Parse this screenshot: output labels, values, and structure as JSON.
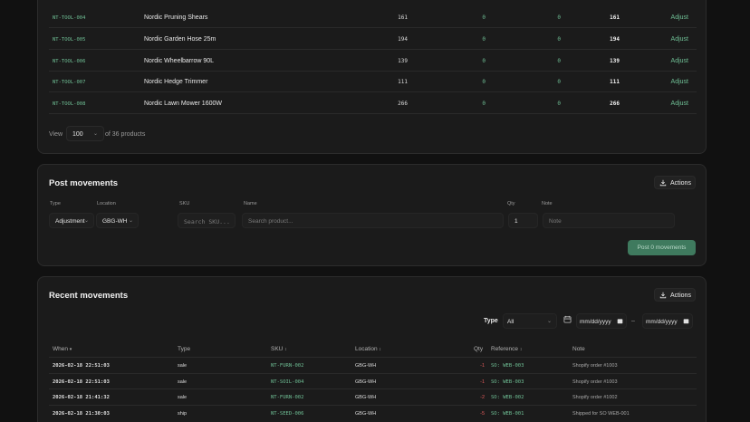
{
  "products": {
    "rows": [
      {
        "sku": "NT-TOOL-004",
        "name": "Nordic Pruning Shears",
        "on_hand": "161",
        "reserved": "0",
        "incoming": "0",
        "available": "161",
        "action": "Adjust"
      },
      {
        "sku": "NT-TOOL-005",
        "name": "Nordic Garden Hose 25m",
        "on_hand": "194",
        "reserved": "0",
        "incoming": "0",
        "available": "194",
        "action": "Adjust"
      },
      {
        "sku": "NT-TOOL-006",
        "name": "Nordic Wheelbarrow 90L",
        "on_hand": "139",
        "reserved": "0",
        "incoming": "0",
        "available": "139",
        "action": "Adjust"
      },
      {
        "sku": "NT-TOOL-007",
        "name": "Nordic Hedge Trimmer",
        "on_hand": "111",
        "reserved": "0",
        "incoming": "0",
        "available": "111",
        "action": "Adjust"
      },
      {
        "sku": "NT-TOOL-008",
        "name": "Nordic Lawn Mower 1600W",
        "on_hand": "266",
        "reserved": "0",
        "incoming": "0",
        "available": "266",
        "action": "Adjust"
      }
    ],
    "view_label": "View",
    "view_value": "100",
    "count_text": "of 36 products"
  },
  "post": {
    "title": "Post movements",
    "actions_label": "Actions",
    "labels": {
      "type": "Type",
      "location": "Location",
      "sku": "SKU",
      "name": "Name",
      "qty": "Qty",
      "note": "Note"
    },
    "type_value": "Adjustment",
    "location_value": "GBG-WH",
    "sku_placeholder": "Search SKU...",
    "name_placeholder": "Search product...",
    "qty_value": "1",
    "note_placeholder": "Note",
    "submit_label": "Post 0 movements"
  },
  "recent": {
    "title": "Recent movements",
    "actions_label": "Actions",
    "filter_type_label": "Type",
    "filter_type_value": "All",
    "date_placeholder": "mm/dd/yyyy",
    "date_sep": "–",
    "headers": {
      "when": "When",
      "type": "Type",
      "sku": "SKU",
      "location": "Location",
      "qty": "Qty",
      "reference": "Reference",
      "note": "Note"
    },
    "rows": [
      {
        "when": "2026-02-18 22:51:03",
        "type": "sale",
        "sku": "NT-FURN-002",
        "location": "GBG-WH",
        "qty": "-1",
        "reference": "SO: WEB-003",
        "note": "Shopify order #1003"
      },
      {
        "when": "2026-02-18 22:51:03",
        "type": "sale",
        "sku": "NT-SOIL-004",
        "location": "GBG-WH",
        "qty": "-1",
        "reference": "SO: WEB-003",
        "note": "Shopify order #1003"
      },
      {
        "when": "2026-02-18 21:41:32",
        "type": "sale",
        "sku": "NT-FURN-002",
        "location": "GBG-WH",
        "qty": "-2",
        "reference": "SO: WEB-002",
        "note": "Shopify order #1002"
      },
      {
        "when": "2026-02-18 21:30:03",
        "type": "ship",
        "sku": "NT-SEED-006",
        "location": "GBG-WH",
        "qty": "-5",
        "reference": "SO: WEB-001",
        "note": "Shipped for SO WEB-001"
      }
    ]
  },
  "colors": {
    "accent": "#6fbf95",
    "negative": "#e05a5a",
    "primary_button": "#3f7a5e",
    "card": "#1b1b1b",
    "background": "#111111"
  }
}
